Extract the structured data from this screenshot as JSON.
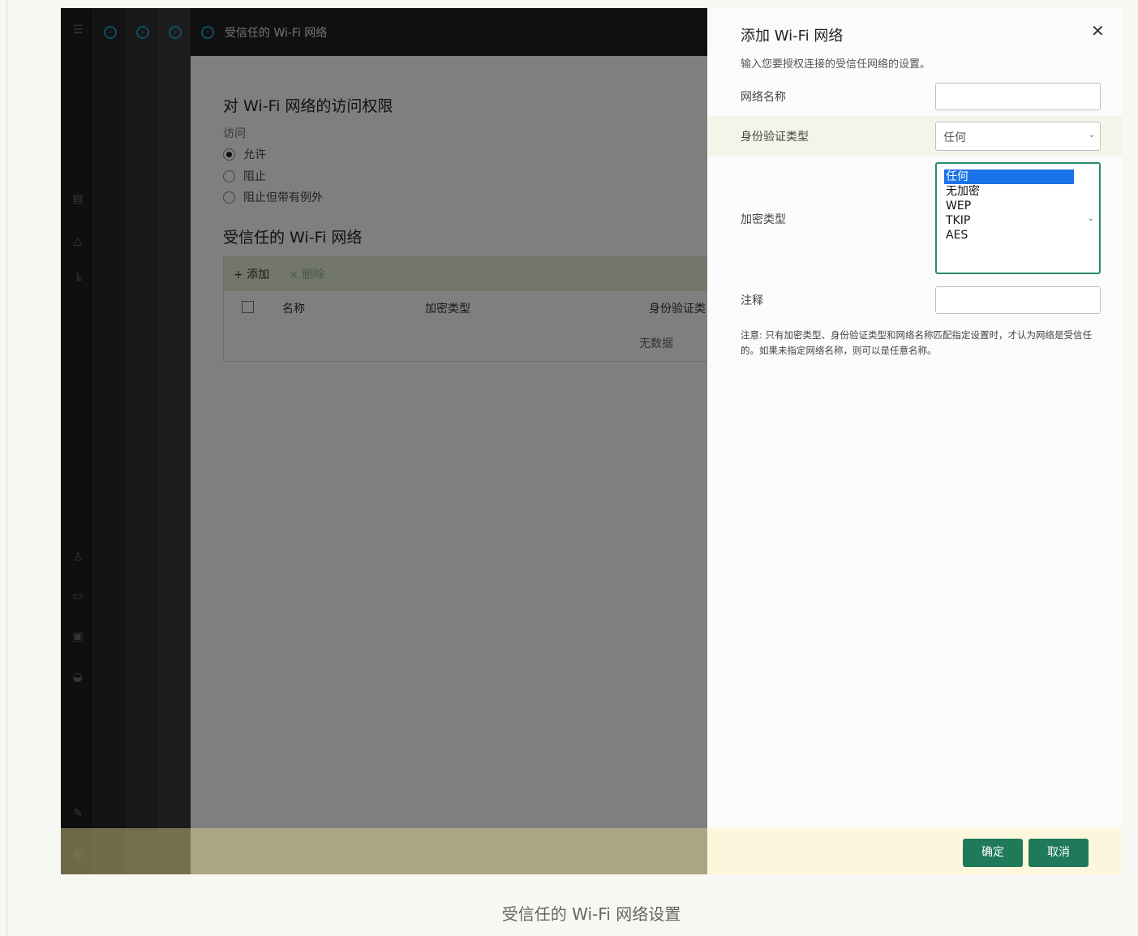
{
  "background_page": {
    "breadcrumb_title": "受信任的 Wi-Fi 网络",
    "section_title": "对 Wi-Fi 网络的访问权限",
    "access_label": "访问",
    "radio_options": [
      "允许",
      "阻止",
      "阻止但带有例外"
    ],
    "selected_radio": "允许",
    "trusted_title": "受信任的 Wi-Fi 网络",
    "toolbar": {
      "add_label": "+ 添加",
      "delete_label": "× 删除"
    },
    "table_headers": [
      "名称",
      "加密类型",
      "身份验证类"
    ],
    "empty_text": "无数据"
  },
  "drawer": {
    "title": "添加 Wi-Fi 网络",
    "subtitle": "输入您要授权连接的受信任网络的设置。",
    "network_name_label": "网络名称",
    "auth_type_label": "身份验证类型",
    "auth_type_value": "任何",
    "encryption_label": "加密类型",
    "encryption_options": [
      "任何",
      "无加密",
      "WEP",
      "TKIP",
      "AES"
    ],
    "encryption_selected": "任何",
    "comment_label": "注释",
    "note": "注意: 只有加密类型、身份验证类型和网络名称匹配指定设置时，才认为网络是受信任的。如果未指定网络名称，则可以是任意名称。",
    "ok_label": "确定",
    "cancel_label": "取消"
  },
  "caption": "受信任的 Wi-Fi 网络设置",
  "colors": {
    "accent_green": "#1f7a5a",
    "selection_blue": "#1a73e8",
    "breadcrumb_blue": "#1a9ad6"
  }
}
